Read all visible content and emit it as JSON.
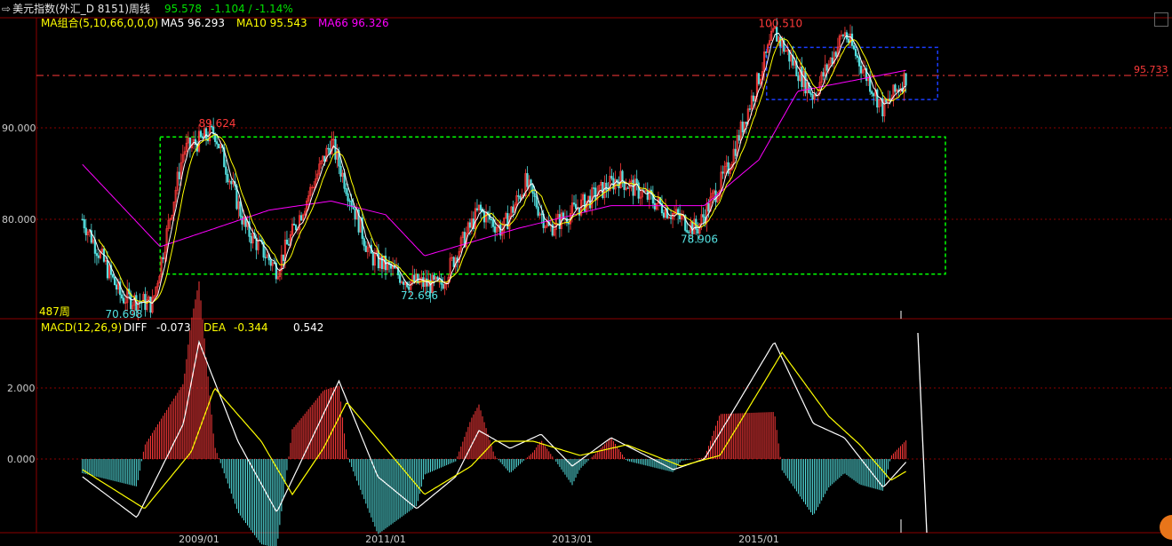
{
  "header": {
    "title": "美元指数(外汇_D 8151)周线",
    "price": "95.578",
    "change": "-1.104 / -1.14%"
  },
  "ma_legend": {
    "name": "MA组合(5,10,66,0,0,0)",
    "ma5": "MA5 96.293",
    "ma10": "MA10 95.543",
    "ma66": "MA66 96.326"
  },
  "macd_legend": {
    "name": "MACD(12,26,9)",
    "diff_label": "DIFF",
    "diff_value": "-0.073",
    "dea_label": "DEA",
    "dea_value": "-0.344",
    "macd_value": "0.542"
  },
  "period_count": "487周",
  "current_price_label": "95.733",
  "colors": {
    "up": "#ff3a3a",
    "down": "#54e1e1",
    "ma5": "#ffffff",
    "ma10": "#ffff00",
    "ma66": "#ff00ff",
    "grid": "#8b0000",
    "green_box": "#00ff00",
    "blue_box": "#1a3cff"
  },
  "chart_data": [
    {
      "type": "candlestick",
      "title": "美元指数(外汇_D 8151)周线",
      "y_ticks": [
        "80.000",
        "90.000"
      ],
      "x_ticks": [
        "2009/01",
        "2011/01",
        "2013/01",
        "2015/01"
      ],
      "ylim": [
        68,
        102
      ],
      "price_path": [
        [
          "2007/10",
          80.0
        ],
        [
          "2008/03",
          71.5
        ],
        [
          "2008/07",
          70.7
        ],
        [
          "2008/11",
          87.5
        ],
        [
          "2009/03",
          89.6
        ],
        [
          "2009/07",
          79.0
        ],
        [
          "2009/11",
          74.5
        ],
        [
          "2010/06",
          88.5
        ],
        [
          "2010/11",
          76.0
        ],
        [
          "2011/04",
          73.2
        ],
        [
          "2011/08",
          72.7
        ],
        [
          "2012/01",
          81.0
        ],
        [
          "2012/04",
          78.8
        ],
        [
          "2012/07",
          84.0
        ],
        [
          "2012/10",
          79.0
        ],
        [
          "2013/07",
          84.5
        ],
        [
          "2014/05",
          78.9
        ],
        [
          "2014/09",
          85.5
        ],
        [
          "2015/03",
          100.5
        ],
        [
          "2015/08",
          93.5
        ],
        [
          "2015/12",
          100.5
        ],
        [
          "2016/05",
          92.0
        ],
        [
          "2016/08",
          95.7
        ]
      ],
      "series": [
        {
          "name": "MA5",
          "value": 96.293
        },
        {
          "name": "MA10",
          "value": 95.543
        },
        {
          "name": "MA66",
          "value": 96.326
        }
      ],
      "ma66_path": [
        [
          "2007/10",
          86.0
        ],
        [
          "2008/08",
          77.0
        ],
        [
          "2009/03",
          79.0
        ],
        [
          "2009/10",
          81.0
        ],
        [
          "2010/06",
          82.0
        ],
        [
          "2011/01",
          80.5
        ],
        [
          "2011/06",
          76.0
        ],
        [
          "2012/06",
          79.0
        ],
        [
          "2013/06",
          81.5
        ],
        [
          "2014/06",
          81.5
        ],
        [
          "2015/01",
          86.5
        ],
        [
          "2015/06",
          94.0
        ],
        [
          "2016/08",
          96.3
        ]
      ],
      "annotations": [
        {
          "text": "89.624",
          "x": "2009/03",
          "y": 89.624
        },
        {
          "text": "70.698",
          "x": "2008/03",
          "y": 70.698
        },
        {
          "text": "72.696",
          "x": "2011/05",
          "y": 72.696
        },
        {
          "text": "78.906",
          "x": "2014/05",
          "y": 78.906
        },
        {
          "text": "100.510",
          "x": "2015/03",
          "y": 100.51
        }
      ],
      "current_price": 95.733,
      "boxes": [
        {
          "color": "green",
          "x0": "2008/08",
          "x1": "2017/01",
          "y0": 74.0,
          "y1": 89.0
        },
        {
          "color": "blue",
          "x0": "2015/02",
          "x1": "2016/12",
          "y0": 93.1,
          "y1": 98.8
        }
      ]
    },
    {
      "type": "line",
      "title": "MACD(12,26,9)",
      "y_ticks": [
        "0.000",
        "2.000"
      ],
      "ylim": [
        -1.8,
        3.5
      ],
      "series": [
        {
          "name": "DIFF",
          "value": -0.073,
          "path": [
            [
              "2007/10",
              -0.5
            ],
            [
              "2008/05",
              -1.65
            ],
            [
              "2008/11",
              1.0
            ],
            [
              "2009/01",
              3.3
            ],
            [
              "2009/06",
              0.5
            ],
            [
              "2009/11",
              -1.5
            ],
            [
              "2010/04",
              0.8
            ],
            [
              "2010/07",
              2.2
            ],
            [
              "2010/12",
              -0.5
            ],
            [
              "2011/05",
              -1.4
            ],
            [
              "2011/10",
              -0.5
            ],
            [
              "2012/01",
              0.8
            ],
            [
              "2012/05",
              0.3
            ],
            [
              "2012/09",
              0.7
            ],
            [
              "2013/01",
              -0.2
            ],
            [
              "2013/06",
              0.6
            ],
            [
              "2014/02",
              -0.3
            ],
            [
              "2014/06",
              0.0
            ],
            [
              "2015/03",
              3.3
            ],
            [
              "2015/08",
              1.0
            ],
            [
              "2015/12",
              0.6
            ],
            [
              "2016/05",
              -0.8
            ],
            [
              "2016/08",
              -0.07
            ]
          ]
        },
        {
          "name": "DEA",
          "value": -0.344,
          "path": [
            [
              "2007/10",
              -0.3
            ],
            [
              "2008/06",
              -1.4
            ],
            [
              "2008/12",
              0.2
            ],
            [
              "2009/03",
              2.0
            ],
            [
              "2009/09",
              0.5
            ],
            [
              "2010/01",
              -1.0
            ],
            [
              "2010/05",
              0.3
            ],
            [
              "2010/08",
              1.6
            ],
            [
              "2011/01",
              0.3
            ],
            [
              "2011/06",
              -1.0
            ],
            [
              "2011/12",
              -0.2
            ],
            [
              "2012/03",
              0.5
            ],
            [
              "2012/08",
              0.5
            ],
            [
              "2013/02",
              0.1
            ],
            [
              "2013/08",
              0.4
            ],
            [
              "2014/03",
              -0.2
            ],
            [
              "2014/08",
              0.1
            ],
            [
              "2015/04",
              3.0
            ],
            [
              "2015/10",
              1.2
            ],
            [
              "2016/02",
              0.4
            ],
            [
              "2016/06",
              -0.6
            ],
            [
              "2016/08",
              -0.34
            ]
          ]
        }
      ],
      "histogram_value": 0.542
    }
  ]
}
